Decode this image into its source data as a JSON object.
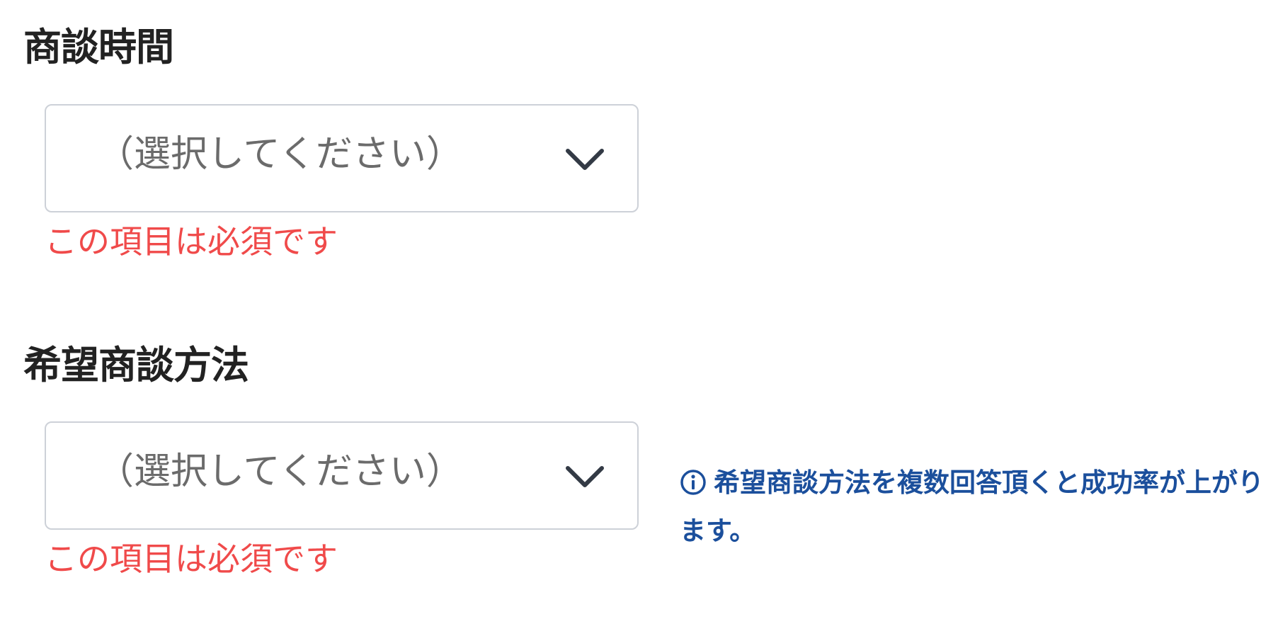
{
  "fields": [
    {
      "label": "商談時間",
      "select_value": "（選択してください）",
      "error": "この項目は必須です"
    },
    {
      "label": "希望商談方法",
      "select_value": "（選択してください）",
      "error": "この項目は必須です",
      "hint": "希望商談方法を複数回答頂くと成功率が上がります。"
    }
  ],
  "colors": {
    "label": "#222222",
    "error": "#f04a4a",
    "hint": "#1b4f9c",
    "border": "#cdd1d8",
    "placeholder": "#6b6b6b"
  },
  "icons": {
    "select_arrow": "chevron-down-icon",
    "hint_icon": "info-icon"
  }
}
